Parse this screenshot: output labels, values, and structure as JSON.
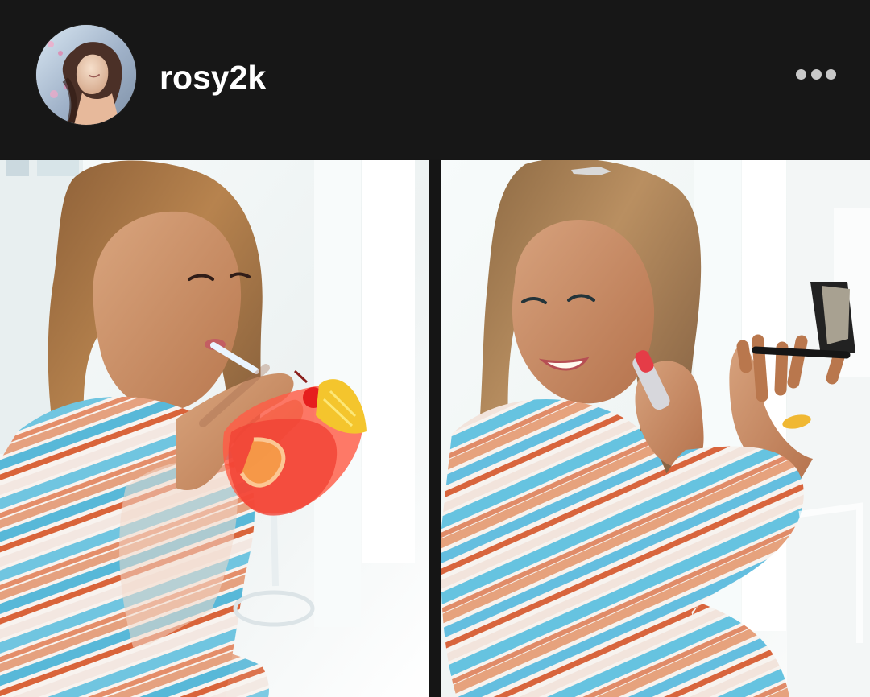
{
  "post": {
    "username": "rosy2k"
  },
  "icons": {
    "avatar": "profile-avatar",
    "more": "more-horizontal-icon"
  },
  "colors": {
    "header_background": "#171717",
    "username_text": "#ffffff",
    "more_icon": "#c8c8c8",
    "gallery_divider": "#151515"
  }
}
